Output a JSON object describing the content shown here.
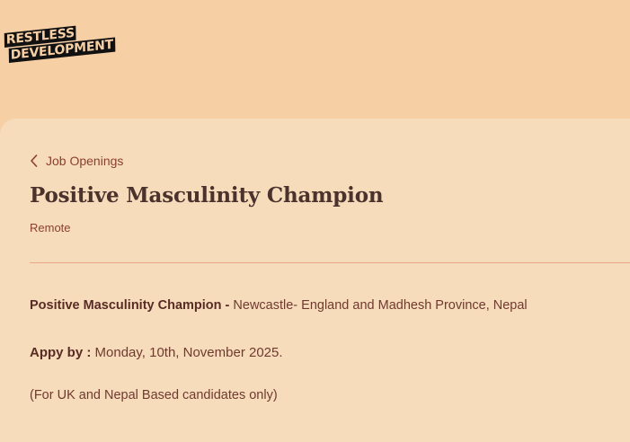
{
  "logo": {
    "line1": "RESTLESS",
    "line2": "DEVELOPMENT"
  },
  "nav": {
    "back_label": "Job Openings",
    "back_icon": "chevron-left-icon"
  },
  "job": {
    "title": "Positive Masculinity Champion",
    "location": "Remote"
  },
  "description": {
    "role_label": "Positive Masculinity Champion -",
    "role_locations": " Newcastle- England and Madhesh Province, Nepal",
    "apply_label": "Appy by :",
    "apply_date": " Monday, 10th, November 2025.",
    "eligibility": "(For UK and Nepal Based candidates only)"
  },
  "colors": {
    "page_background": "#f6cfa5",
    "card_background": "#f7dcbc",
    "accent_text": "#8a3f2c",
    "title_text": "#4b322c",
    "divider": "#e7a984"
  }
}
